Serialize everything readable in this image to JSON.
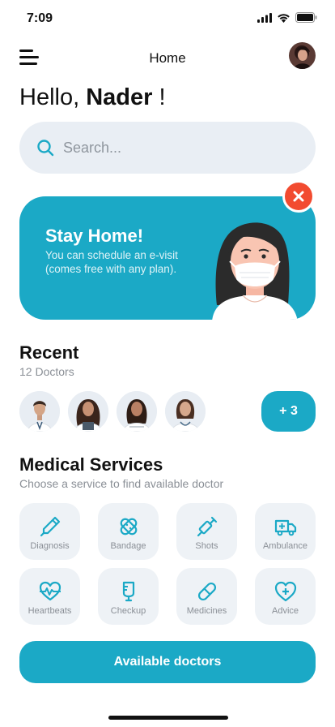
{
  "status_bar": {
    "time": "7:09"
  },
  "nav": {
    "title": "Home"
  },
  "greeting": {
    "hello": "Hello,",
    "name": "Nader",
    "suffix": "!"
  },
  "search": {
    "placeholder": "Search..."
  },
  "banner": {
    "title": "Stay Home!",
    "text": "You can schedule an e-visit (comes free with any plan)."
  },
  "recent": {
    "title": "Recent",
    "count_label": "12 Doctors",
    "more_label": "+ 3"
  },
  "medical_services": {
    "title": "Medical Services",
    "subtitle": "Choose a service to find available doctor",
    "items": [
      {
        "label": "Diagnosis",
        "icon": "syringe-pen-icon"
      },
      {
        "label": "Bandage",
        "icon": "bandage-icon"
      },
      {
        "label": "Shots",
        "icon": "syringe-icon"
      },
      {
        "label": "Ambulance",
        "icon": "ambulance-icon"
      },
      {
        "label": "Heartbeats",
        "icon": "heartbeat-icon"
      },
      {
        "label": "Checkup",
        "icon": "iv-drip-icon"
      },
      {
        "label": "Medicines",
        "icon": "pill-icon"
      },
      {
        "label": "Advice",
        "icon": "heart-plus-icon"
      }
    ]
  },
  "cta": {
    "label": "Available doctors"
  },
  "colors": {
    "accent": "#1ba9c6",
    "close": "#f24b30",
    "tile": "#eef2f6",
    "search_bg": "#e9eef4"
  }
}
